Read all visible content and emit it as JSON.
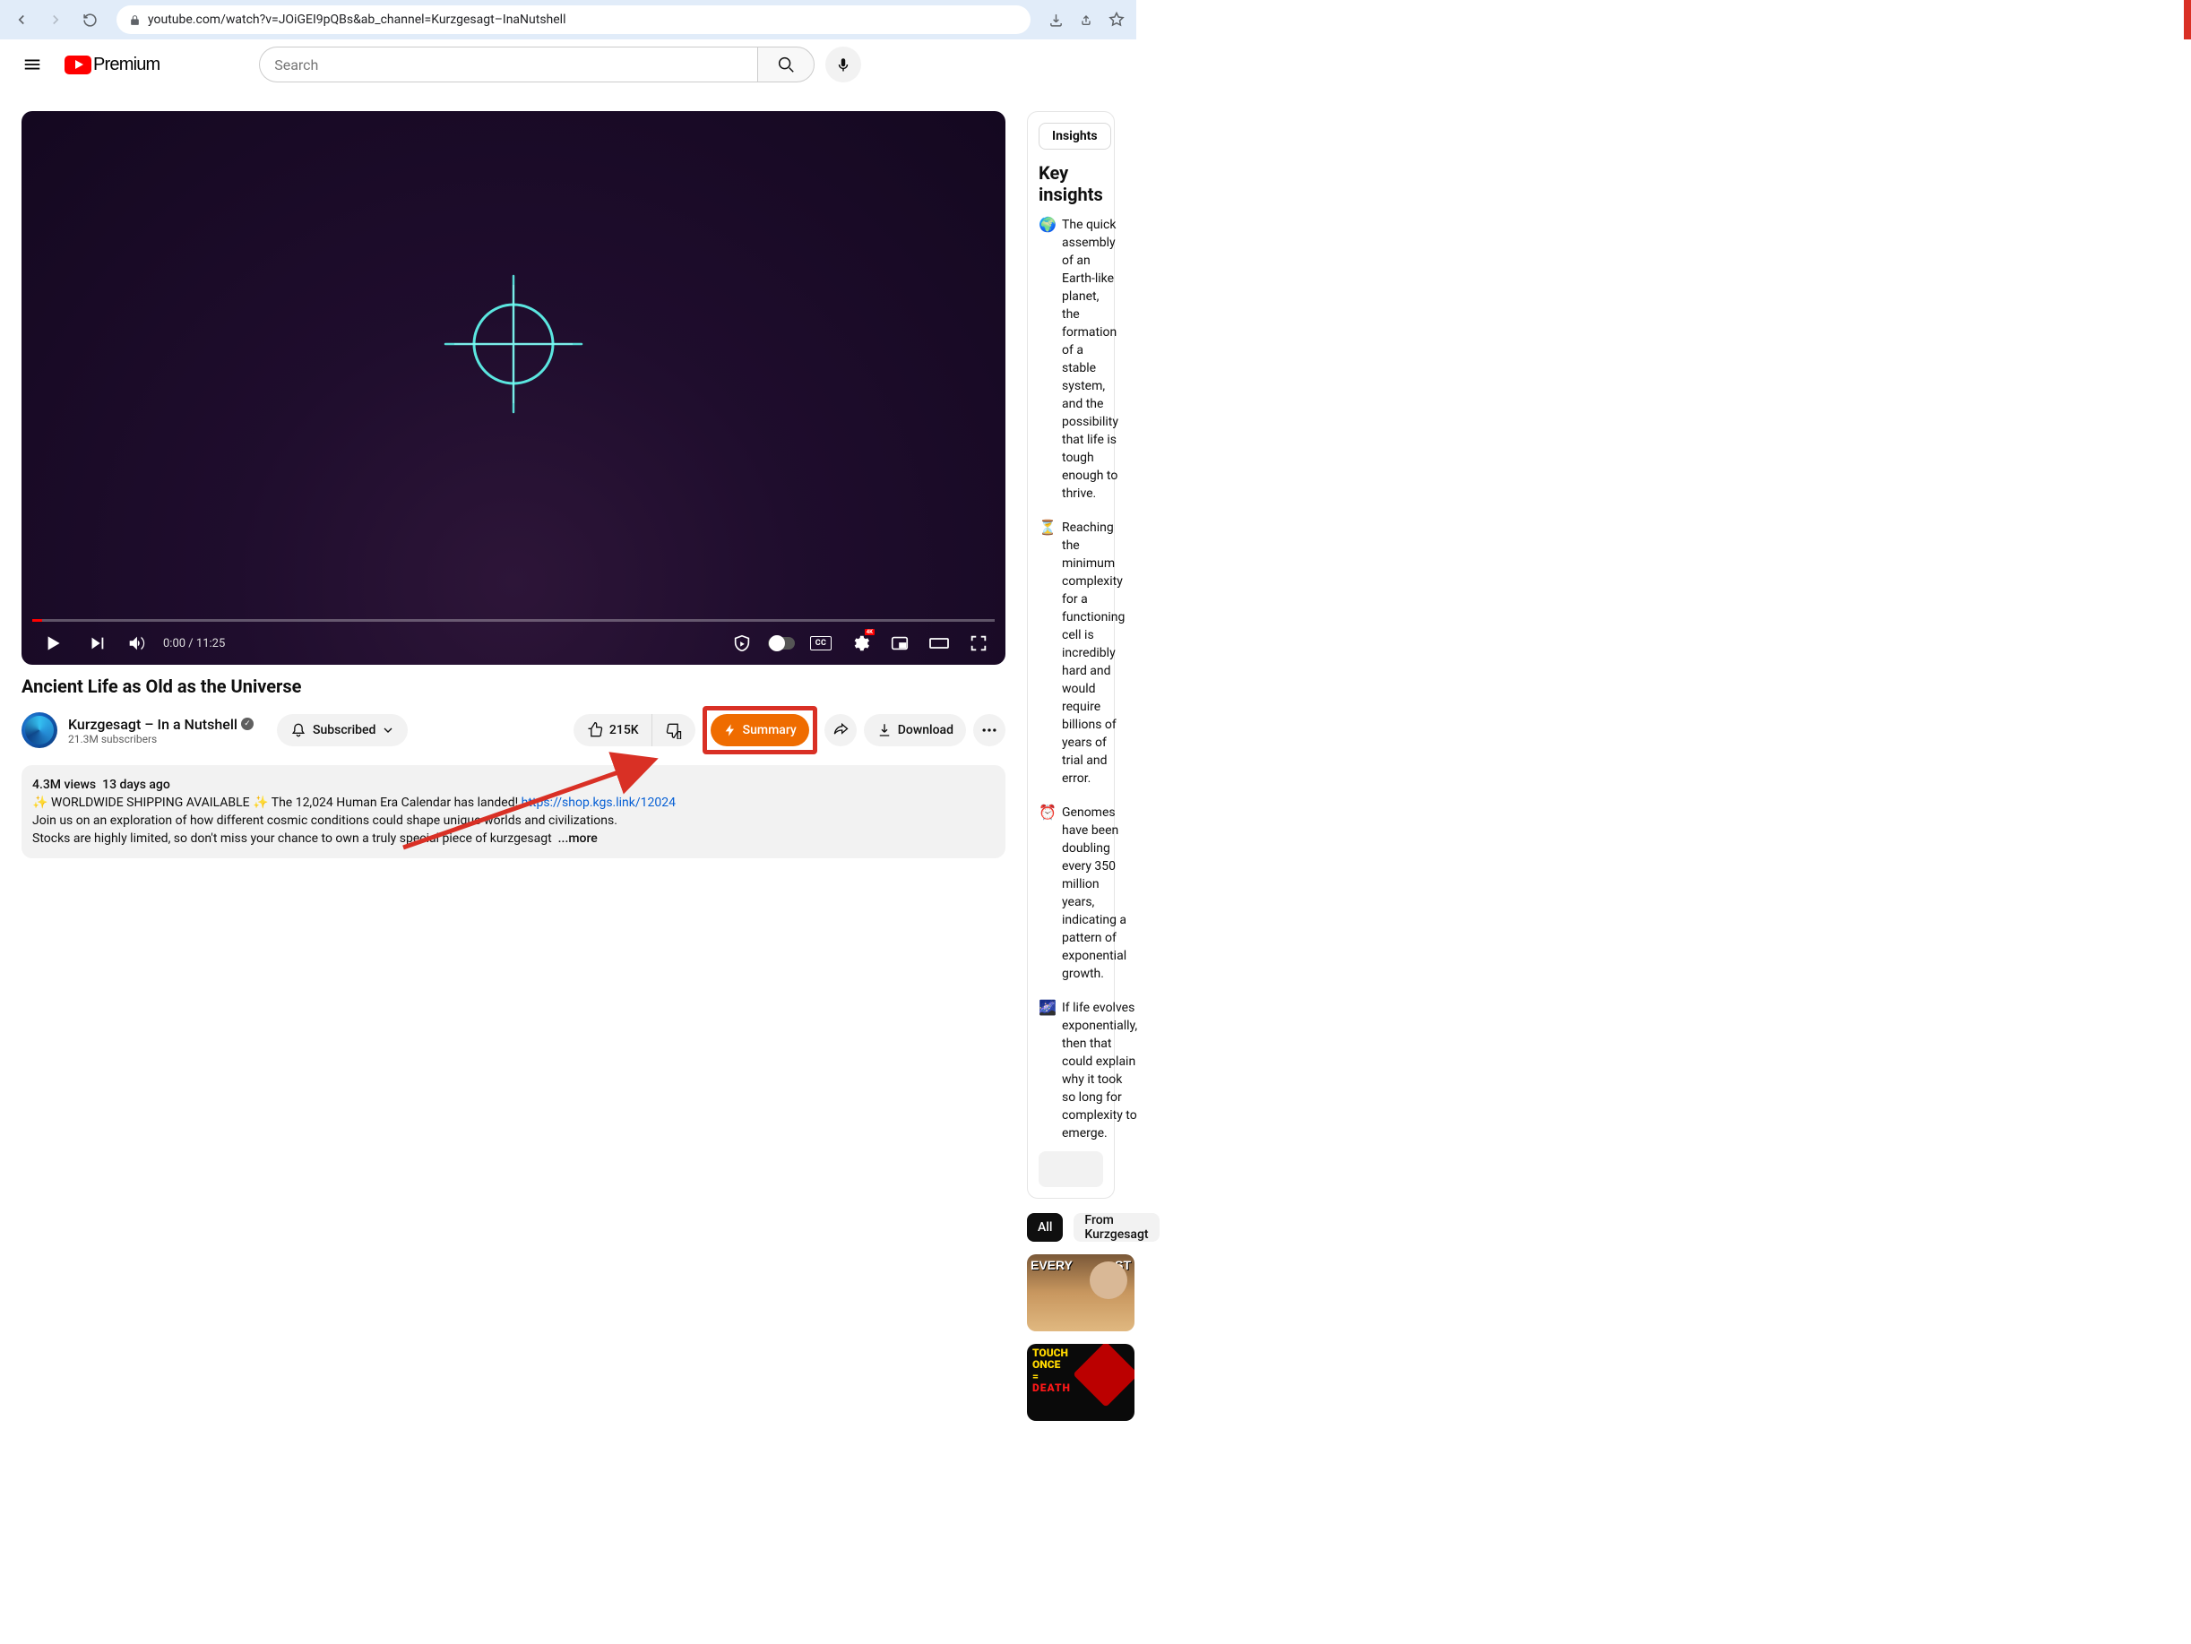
{
  "browser": {
    "url": "youtube.com/watch?v=JOiGEI9pQBs&ab_channel=Kurzgesagt–InaNutshell",
    "domain": "youtube.com"
  },
  "header": {
    "logo_text": "Premium",
    "search_placeholder": "Search"
  },
  "player": {
    "time_current": "0:00",
    "time_total": "11:25",
    "cc_label": "CC",
    "quality_badge": "4K"
  },
  "video": {
    "title": "Ancient Life as Old as the Universe",
    "channel_name": "Kurzgesagt – In a Nutshell",
    "subscribers": "21.3M subscribers",
    "subscribe_label": "Subscribed",
    "likes": "215K",
    "summary_label": "Summary",
    "download_label": "Download"
  },
  "description": {
    "views": "4.3M views",
    "age": "13 days ago",
    "line1_pre": "✨ WORLDWIDE SHIPPING AVAILABLE ✨ The 12,024 Human Era Calendar has landed! ",
    "line1_link": "https://shop.kgs.link/12024",
    "line2": "Join us on an exploration of how different cosmic conditions could shape unique worlds and civilizations.",
    "line3": "Stocks are highly limited, so don't miss your chance to own a truly special piece of kurzgesagt",
    "more": "...more"
  },
  "sidebar": {
    "insights_tab": "Insights",
    "insights_title": "Key insights",
    "insights": [
      {
        "emoji": "🌍",
        "text": "The quick assembly of an Earth-like planet, the formation of a stable system, and the possibility that life is tough enough to thrive."
      },
      {
        "emoji": "⏳",
        "text": "Reaching the minimum complexity for a functioning cell is incredibly hard and would require billions of years of trial and error."
      },
      {
        "emoji": "⏰",
        "text": "Genomes have been doubling every 350 million years, indicating a pattern of exponential growth."
      },
      {
        "emoji": "🌌",
        "text": "If life evolves exponentially, then that could explain why it took so long for complexity to emerge."
      }
    ],
    "chips": {
      "all": "All",
      "from": "From Kurzgesagt"
    },
    "related": [
      {
        "overlay_left": "EVERY",
        "overlay_right": "ST"
      },
      {
        "line1": "TOUCH",
        "line2": "ONCE",
        "eq": "=",
        "line3": "DEATH"
      }
    ]
  }
}
